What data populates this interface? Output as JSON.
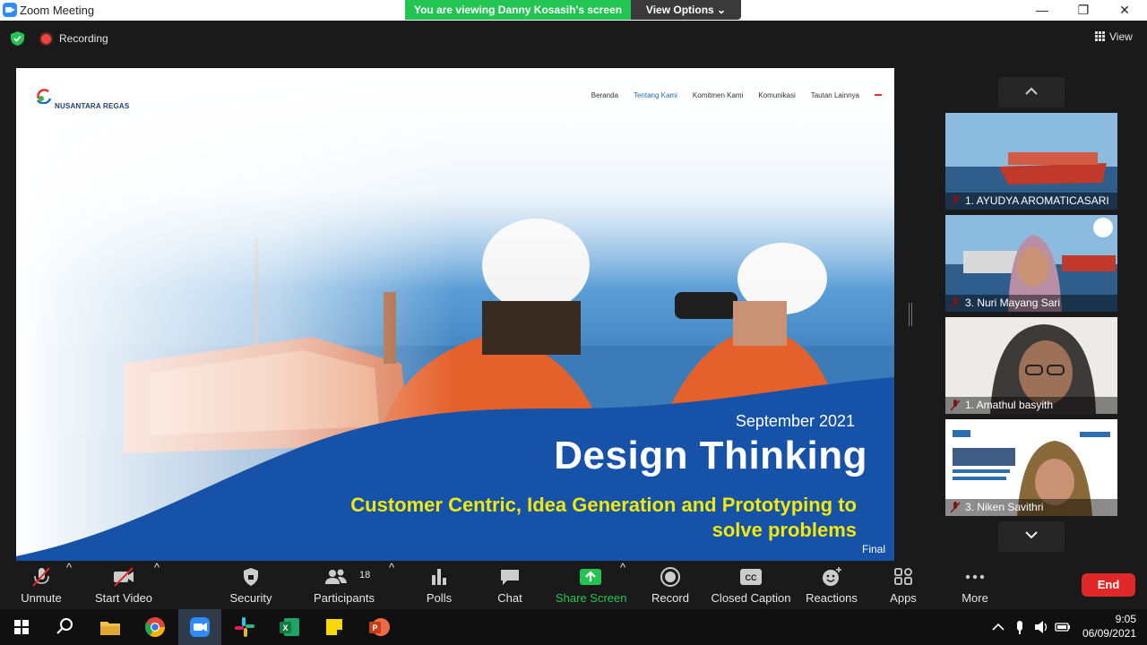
{
  "window": {
    "title": "Zoom Meeting",
    "minimize": "—",
    "maximize": "❐",
    "close": "✕"
  },
  "banner": {
    "viewing": "You are viewing Danny Kosasih's screen",
    "view_options": "View Options ⌄"
  },
  "meeting": {
    "recording": "Recording",
    "view": "View"
  },
  "slide": {
    "nav": [
      "Beranda",
      "Tentang Kami",
      "Komitmen Kami",
      "Komunikasi",
      "Tautan Lainnya"
    ],
    "logo_text": "NUSANTARA REGAS",
    "date": "September 2021",
    "title": "Design Thinking",
    "subtitle_line1": "Customer Centric, Idea Generation and Prototyping to",
    "subtitle_line2": "solve problems",
    "final": "Final"
  },
  "participants": [
    {
      "name": "1. AYUDYA AROMATICASARI"
    },
    {
      "name": "3. Nuri Mayang Sari"
    },
    {
      "name": "1. Amathul basyith"
    },
    {
      "name": "3. Niken Savithri"
    }
  ],
  "toolbar": {
    "unmute": "Unmute",
    "start_video": "Start Video",
    "security": "Security",
    "participants": "Participants",
    "participants_count": "18",
    "polls": "Polls",
    "chat": "Chat",
    "share_screen": "Share Screen",
    "record": "Record",
    "closed_caption": "Closed Caption",
    "reactions": "Reactions",
    "apps": "Apps",
    "more": "More",
    "end": "End",
    "caret": "^"
  },
  "taskbar": {
    "time": "9:05",
    "date": "06/09/2021"
  },
  "colors": {
    "share_green": "#23c552",
    "end_red": "#e02828",
    "zoom_blue": "#2d8cff",
    "slide_blue": "#1552a8",
    "subtitle_yellow": "#f2e80d"
  }
}
